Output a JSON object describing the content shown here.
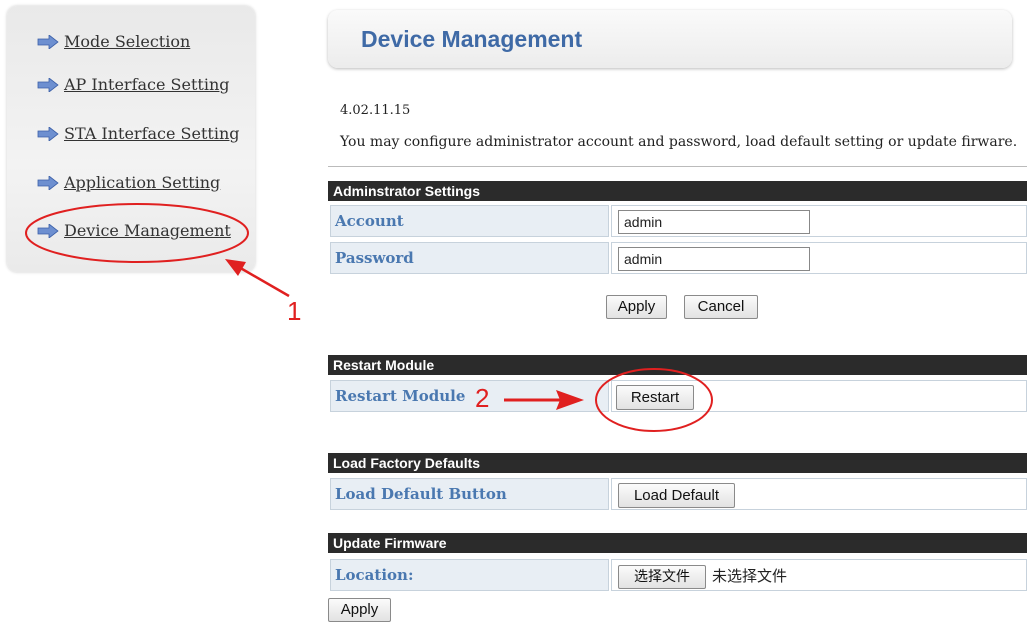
{
  "sidebar": {
    "items": [
      {
        "label": "Mode Selection"
      },
      {
        "label": "AP Interface Setting"
      },
      {
        "label": "STA Interface Setting"
      },
      {
        "label": "Application Setting"
      },
      {
        "label": "Device Management"
      }
    ]
  },
  "header": {
    "title": "Device Management"
  },
  "version": "4.02.11.15",
  "description": "You may configure administrator account and password, load default setting or update firware.",
  "admin": {
    "heading": "Adminstrator Settings",
    "account_label": "Account",
    "account_value": "admin",
    "password_label": "Password",
    "password_value": "admin",
    "apply_label": "Apply",
    "cancel_label": "Cancel"
  },
  "restart": {
    "heading": "Restart Module",
    "row_label": "Restart Module",
    "button_label": "Restart"
  },
  "factory": {
    "heading": "Load Factory Defaults",
    "row_label": "Load Default Button",
    "button_label": "Load Default"
  },
  "firmware": {
    "heading": "Update Firmware",
    "row_label": "Location:",
    "choose_file_label": "选择文件",
    "file_status": "未选择文件",
    "apply_label": "Apply"
  },
  "annotations": {
    "marker1": "1",
    "marker2": "2"
  },
  "colors": {
    "accent": "#3f6aa6",
    "label_text": "#4a78b0",
    "section_header": "#2b2b2b",
    "annotation": "#e02020"
  }
}
